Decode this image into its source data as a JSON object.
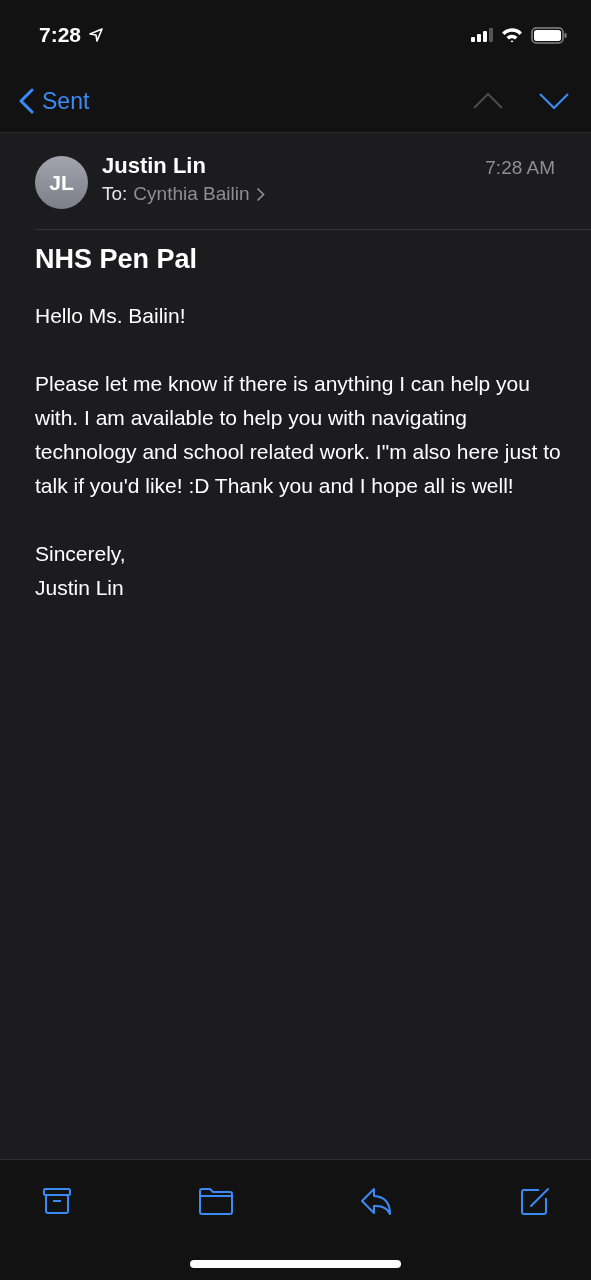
{
  "status_bar": {
    "time": "7:28"
  },
  "nav": {
    "back_label": "Sent",
    "previous_disabled": true,
    "next_disabled": false
  },
  "message": {
    "sender": "Justin Lin",
    "initials": "JL",
    "to_label": "To:",
    "recipient": "Cynthia Bailin",
    "time": "7:28 AM",
    "subject": "NHS Pen Pal",
    "paragraphs": [
      "Hello Ms. Bailin!",
      "Please let me know if there is anything I can help you with. I am available to help you with navigating technology and school related work. I\"m also here just to talk if you'd like! :D Thank you and I hope all is well!",
      "Sincerely,\nJustin Lin"
    ]
  }
}
